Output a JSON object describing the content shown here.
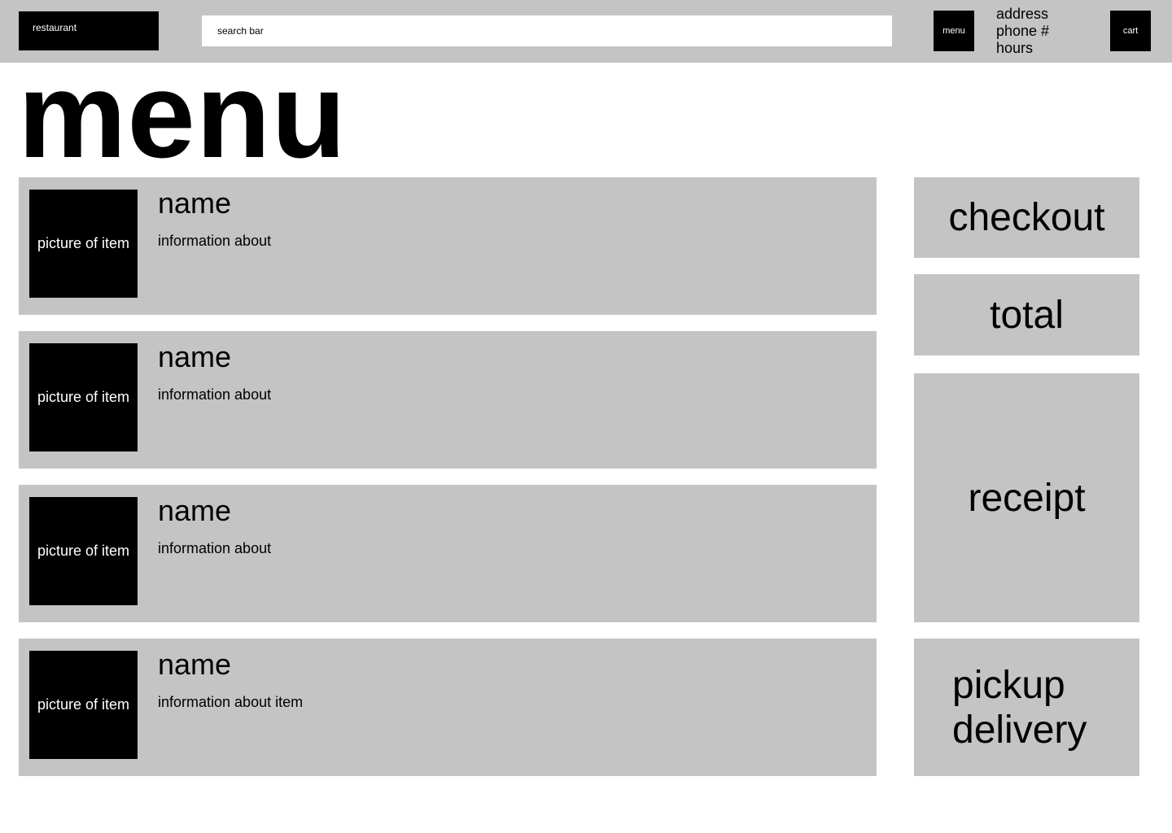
{
  "header": {
    "logo_label": "restaurant",
    "search_placeholder": "search bar",
    "menu_label": "menu",
    "cart_label": "cart",
    "info": [
      "address",
      "phone #",
      "hours"
    ]
  },
  "page_title": "menu",
  "menu_items": [
    {
      "picture_label": "picture of item",
      "name": "name",
      "info": "information about"
    },
    {
      "picture_label": "picture of item",
      "name": "name",
      "info": "information about"
    },
    {
      "picture_label": "picture of item",
      "name": "name",
      "info": "information about"
    },
    {
      "picture_label": "picture of item",
      "name": "name",
      "info": "information about item"
    }
  ],
  "side_panel": {
    "checkout_label": "checkout",
    "total_label": "total",
    "receipt_label": "receipt",
    "fulfillment_options": [
      "pickup",
      "delivery"
    ]
  },
  "colors": {
    "panel_gray": "#c4c4c4",
    "block_black": "#000000",
    "background": "#ffffff"
  }
}
